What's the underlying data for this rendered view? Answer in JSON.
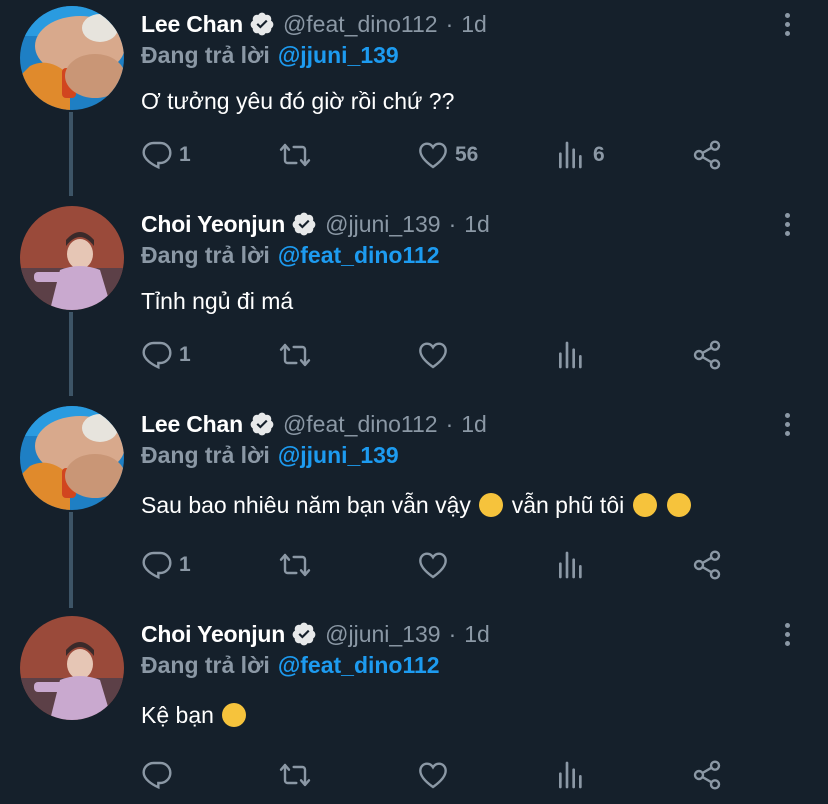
{
  "tweets": [
    {
      "name": "Lee Chan",
      "handle": "@feat_dino112",
      "time": "1d",
      "reply_prefix": "Đang trả lời",
      "reply_to": "@jjuni_139",
      "text": "Ơ tưởng yêu đó giờ rồi chứ ??",
      "replies": "1",
      "likes": "56",
      "views": "6",
      "avatar": "avatar-lee-chan"
    },
    {
      "name": "Choi Yeonjun",
      "handle": "@jjuni_139",
      "time": "1d",
      "reply_prefix": "Đang trả lời",
      "reply_to": "@feat_dino112",
      "text": "Tỉnh ngủ đi má",
      "replies": "1",
      "avatar": "avatar-choi-yeonjun"
    },
    {
      "name": "Lee Chan",
      "handle": "@feat_dino112",
      "time": "1d",
      "reply_prefix": "Đang trả lời",
      "reply_to": "@jjuni_139",
      "text": "Sau bao nhiêu năm bạn vẫn vậy",
      "text_b": "vẫn phũ tôi",
      "replies": "1",
      "avatar": "avatar-lee-chan"
    },
    {
      "name": "Choi Yeonjun",
      "handle": "@jjuni_139",
      "time": "1d",
      "reply_prefix": "Đang trả lời",
      "reply_to": "@feat_dino112",
      "text": "Kệ bạn",
      "avatar": "avatar-choi-yeonjun"
    }
  ],
  "icons": [
    "reply-icon",
    "retweet-icon",
    "like-icon",
    "views-icon",
    "share-icon",
    "more-icon",
    "verified-badge-icon"
  ],
  "colors": {
    "background": "#15202b",
    "accent": "#1d9bf0",
    "muted": "#8b98a5",
    "thread_line": "#3d5466"
  }
}
